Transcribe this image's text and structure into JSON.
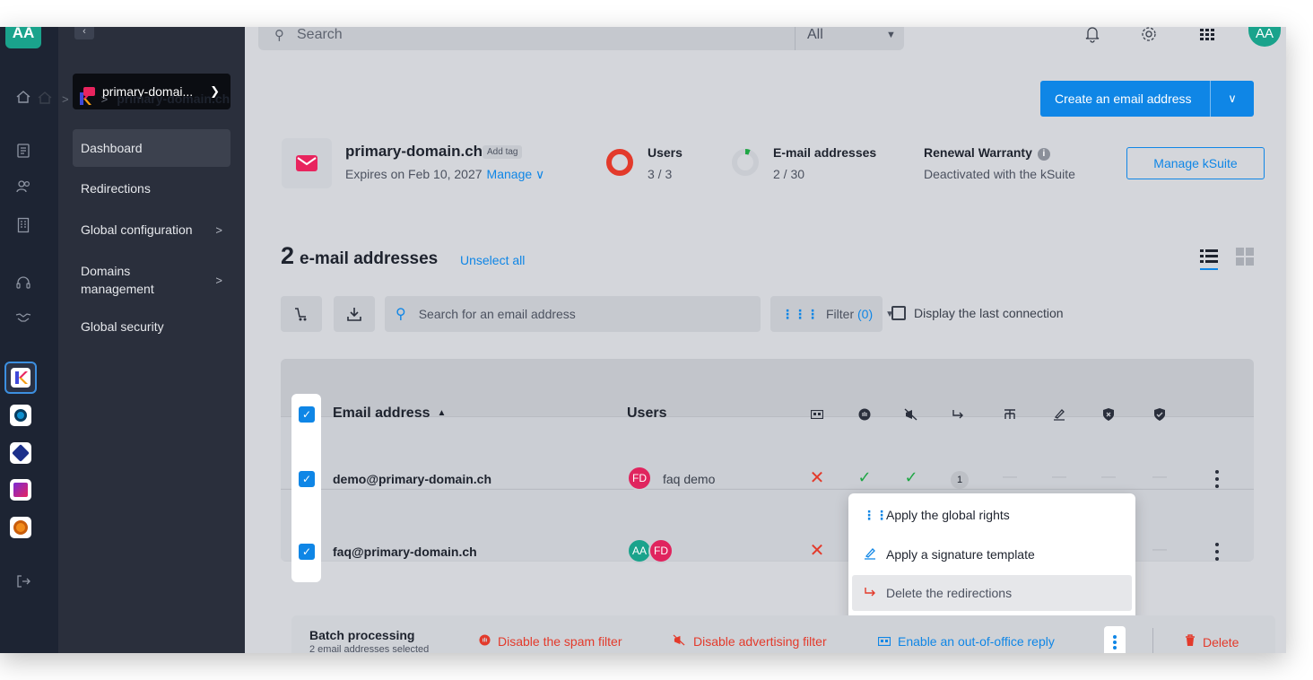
{
  "rail": {
    "avatar": "AA"
  },
  "sidebar": {
    "domain_select": "primary-domai...",
    "items": [
      {
        "label": "Dashboard"
      },
      {
        "label": "Redirections"
      },
      {
        "label": "Global configuration"
      },
      {
        "label": "Domains management"
      },
      {
        "label": "Global security"
      }
    ]
  },
  "topbar": {
    "search_placeholder": "Search",
    "scope": "All",
    "avatar": "AA"
  },
  "breadcrumb": {
    "current": "primary-domain.ch"
  },
  "create_button": "Create an email address",
  "header": {
    "domain": "primary-domain.ch",
    "add_tag": "Add tag",
    "expires": "Expires on Feb 10, 2027",
    "manage": "Manage",
    "users_title": "Users",
    "users_value": "3 / 3",
    "emails_title": "E-mail addresses",
    "emails_value": "2 / 30",
    "warranty_title": "Renewal Warranty",
    "warranty_value": "Deactivated with the kSuite",
    "ksuite_button": "Manage kSuite",
    "colors": {
      "users_ring": "#e33a2b",
      "emails_ring_fill": "#1fa645",
      "brand_pink": "#e8245e",
      "primary_blue": "#0f86e6"
    },
    "users_fill_fraction": 1.0,
    "emails_fill_fraction": 0.0667
  },
  "list": {
    "count": "2",
    "title": "e-mail addresses",
    "unselect_all": "Unselect all",
    "search_placeholder": "Search for an email address",
    "filter_label": "Filter",
    "filter_count": "(0)",
    "display_last_connection": "Display the last connection"
  },
  "table": {
    "col_email": "Email address",
    "col_users": "Users",
    "icon_columns": [
      "out-of-office-icon",
      "spam-filter-icon",
      "advertising-filter-icon",
      "redirection-icon",
      "hierarchy-icon",
      "signature-icon",
      "shield-x-icon",
      "shield-check-icon"
    ],
    "rows": [
      {
        "email": "demo@primary-domain.ch",
        "avatars": [
          {
            "initials": "FD",
            "color": "#e0245e"
          }
        ],
        "user_name": "faq demo",
        "redirections": "1"
      },
      {
        "email": "faq@primary-domain.ch",
        "avatars": [
          {
            "initials": "AA",
            "color": "#1aa38c"
          },
          {
            "initials": "FD",
            "color": "#e0245e"
          }
        ]
      }
    ]
  },
  "menu": {
    "items": [
      {
        "label": "Apply the global rights"
      },
      {
        "label": "Apply a signature template"
      },
      {
        "label": "Delete the redirections"
      }
    ]
  },
  "batch": {
    "title": "Batch processing",
    "subtitle": "2 email addresses selected",
    "disable_spam": "Disable the spam filter",
    "disable_ads": "Disable advertising filter",
    "enable_ooo": "Enable an out-of-office reply",
    "delete": "Delete"
  }
}
